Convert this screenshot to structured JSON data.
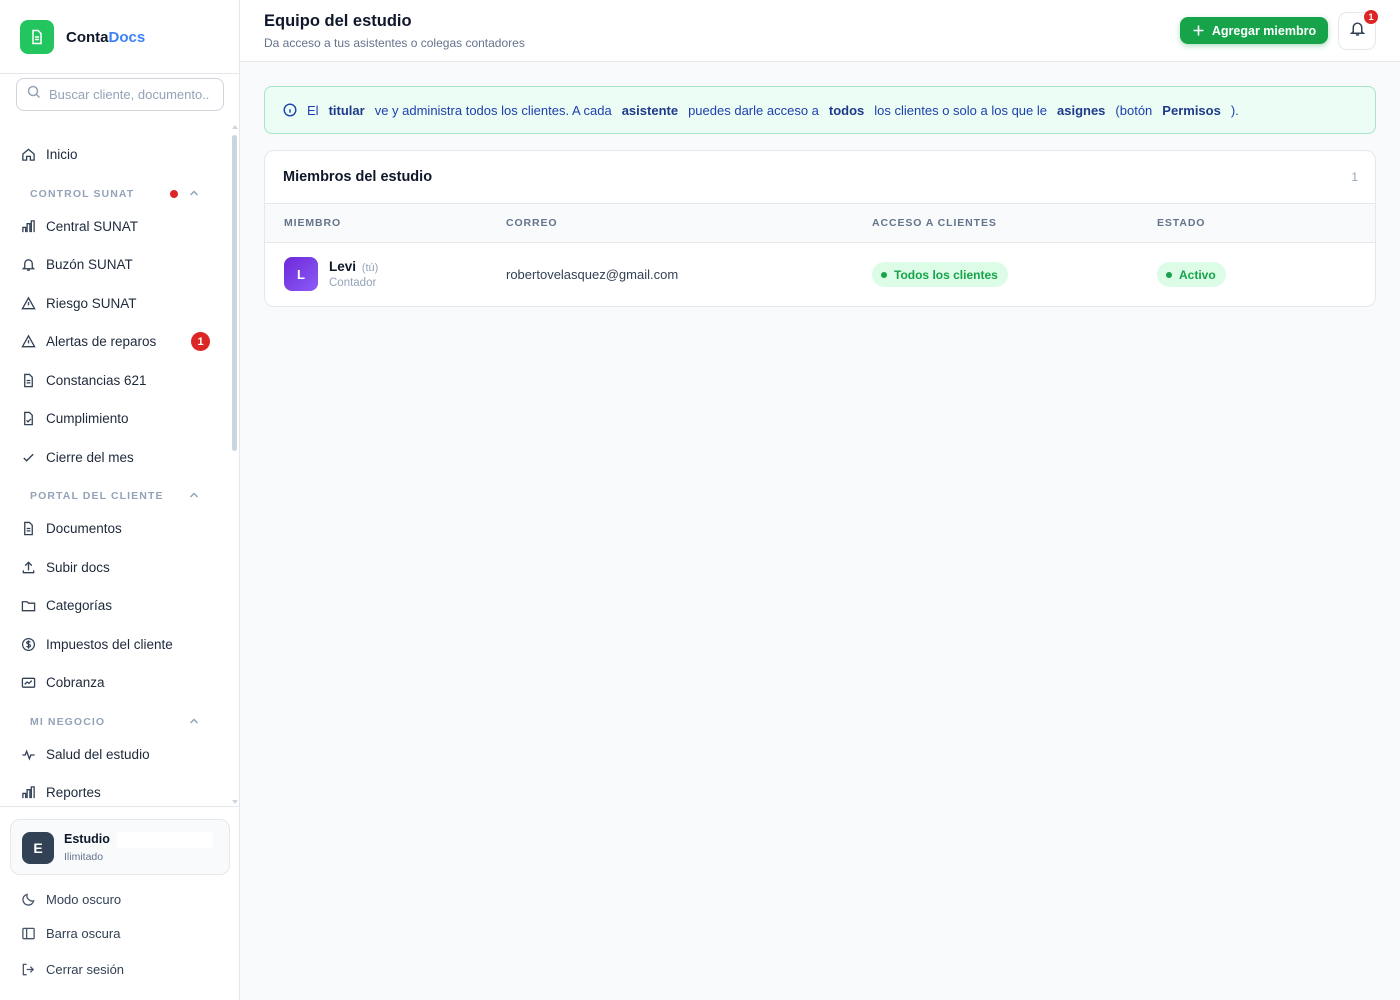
{
  "brand": {
    "name_part1": "Conta",
    "name_part2": "Docs"
  },
  "search": {
    "placeholder": "Buscar cliente, documento..."
  },
  "nav": {
    "home": "Inicio",
    "sections": [
      {
        "title": "CONTROL SUNAT"
      },
      {
        "title": "PORTAL DEL CLIENTE"
      },
      {
        "title": "MI NEGOCIO"
      }
    ],
    "items": [
      {
        "label": "Central SUNAT"
      },
      {
        "label": "Buzón SUNAT"
      },
      {
        "label": "Riesgo SUNAT"
      },
      {
        "label": "Alertas de reparos",
        "badge": "1"
      },
      {
        "label": "Constancias 621"
      },
      {
        "label": "Cumplimiento"
      },
      {
        "label": "Cierre del mes"
      },
      {
        "label": "Documentos"
      },
      {
        "label": "Subir docs"
      },
      {
        "label": "Categorías"
      },
      {
        "label": "Impuestos del cliente"
      },
      {
        "label": "Cobranza"
      },
      {
        "label": "Salud del estudio"
      },
      {
        "label": "Reportes"
      }
    ]
  },
  "account": {
    "initial": "E",
    "name": "Estudio",
    "plan": "Ilimitado"
  },
  "footer": {
    "dark_mode": "Modo oscuro",
    "dark_bar": "Barra oscura",
    "logout": "Cerrar sesión"
  },
  "header": {
    "title": "Equipo del estudio",
    "subtitle": "Da acceso a tus asistentes o colegas contadores",
    "add_button": "Agregar miembro",
    "notif_count": "1"
  },
  "info": {
    "p1": "El",
    "b1": "titular",
    "p2": "ve y administra todos los clientes. A cada",
    "b2": "asistente",
    "p3": "puedes darle acceso a",
    "b3": "todos",
    "p4": "los clientes o solo a los que le",
    "b4": "asignes",
    "p5": "(botón",
    "b5": "Permisos",
    "p6": ")."
  },
  "members": {
    "title": "Miembros del estudio",
    "count": "1",
    "columns": [
      "MIEMBRO",
      "CORREO",
      "ACCESO A CLIENTES",
      "ESTADO"
    ],
    "rows": [
      {
        "initial": "L",
        "name": "Levi",
        "you": "(tú)",
        "role": "Contador",
        "email": "robertovelasquez@gmail.com",
        "access": "Todos los clientes",
        "status": "Activo"
      }
    ]
  },
  "colors": {
    "brand_green": "#22c55e",
    "primary_button": "#16a34a",
    "accent_blue": "#3b82f6",
    "alert_red": "#dc2626",
    "avatar_purple": "#7c3aed"
  }
}
